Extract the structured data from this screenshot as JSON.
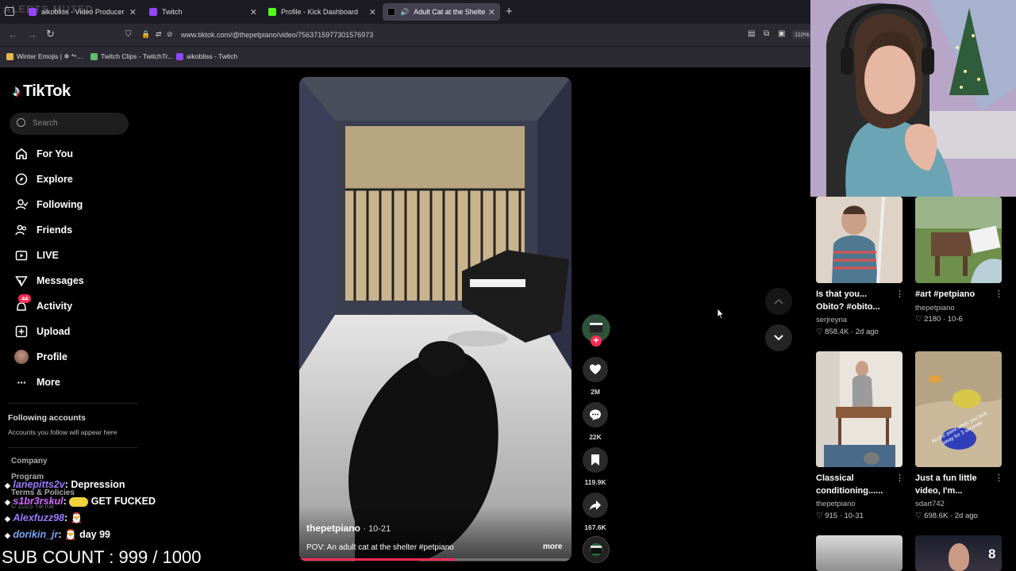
{
  "browser": {
    "tabs": [
      {
        "label": "aikobliss - Video Producer - Tw",
        "active": false
      },
      {
        "label": "Twitch",
        "active": false
      },
      {
        "label": "Profile - Kick Dashboard",
        "active": false
      },
      {
        "label": "Adult Cat at the Shelter: A",
        "active": true
      }
    ],
    "url": "www.tiktok.com/@thepetpiano/video/7563715977301576973",
    "zoom": "110%",
    "bookmarks": [
      "Winter Emojis | ❄ *ⁿ…",
      "Twitch Clips - TwitchTr...",
      "aikobliss - Twitch"
    ]
  },
  "tiktok": {
    "logo": "TikTok",
    "search_placeholder": "Search",
    "nav": [
      {
        "label": "For You",
        "icon": "home-icon"
      },
      {
        "label": "Explore",
        "icon": "compass-icon"
      },
      {
        "label": "Following",
        "icon": "following-icon"
      },
      {
        "label": "Friends",
        "icon": "friends-icon"
      },
      {
        "label": "LIVE",
        "icon": "live-icon"
      },
      {
        "label": "Messages",
        "icon": "messages-icon"
      },
      {
        "label": "Activity",
        "icon": "activity-icon"
      },
      {
        "label": "Upload",
        "icon": "upload-icon"
      },
      {
        "label": "Profile",
        "icon": "avatar"
      },
      {
        "label": "More",
        "icon": "more-icon"
      }
    ],
    "activity_badge": "44",
    "following_header": "Following accounts",
    "following_note": "Accounts you follow will appear here",
    "footer": [
      "Company",
      "Program",
      "Terms & Policies",
      "© 2025 TikTok"
    ],
    "video": {
      "author": "thepetpiano",
      "date": "· 10-21",
      "caption": "POV: An adult cat at the shelter #petpiano",
      "more": "more",
      "progress": 0.57
    },
    "actions": {
      "likes": "2M",
      "comments": "22K",
      "saves": "119.9K",
      "shares": "167.6K"
    },
    "related": [
      {
        "title": "Is that you... Obito? #obito...",
        "author": "serjreyna",
        "likes": "858.4K",
        "date": "2d ago"
      },
      {
        "title": "#art #petpiano",
        "author": "thepetpiano",
        "likes": "2180",
        "date": "10-6"
      },
      {
        "title": "Classical conditioning......",
        "author": "thepetpiano",
        "likes": "915",
        "date": "10-31"
      },
      {
        "title": "Just a fun little video, I'm...",
        "author": "sdart742",
        "likes": "698.6K",
        "date": "2d ago"
      }
    ],
    "thumb_overlay_text": "Acrylic paint when you look away for 3 seconds",
    "thumb_badge": "8"
  },
  "overlay": {
    "alert_text": "ALERTS MUTED",
    "chat": [
      {
        "user": "lanepitts2v",
        "msg": "Depression",
        "color": "#9a7bff"
      },
      {
        "user": "s1br3rskul",
        "msg": "GET FUCKED",
        "color": "#d36bff"
      },
      {
        "user": "Alexfuzz98",
        "msg": "🎅",
        "color": "#9a7bff"
      },
      {
        "user": "dorikin_jr",
        "msg": "🎅 day 99",
        "color": "#7aa9ff"
      }
    ],
    "sub_count": "SUB COUNT : 999 / 1000"
  },
  "colors": {
    "accent": "#fe2c55",
    "chrome_dark": "#1c1b22",
    "chrome": "#2b2a33"
  }
}
